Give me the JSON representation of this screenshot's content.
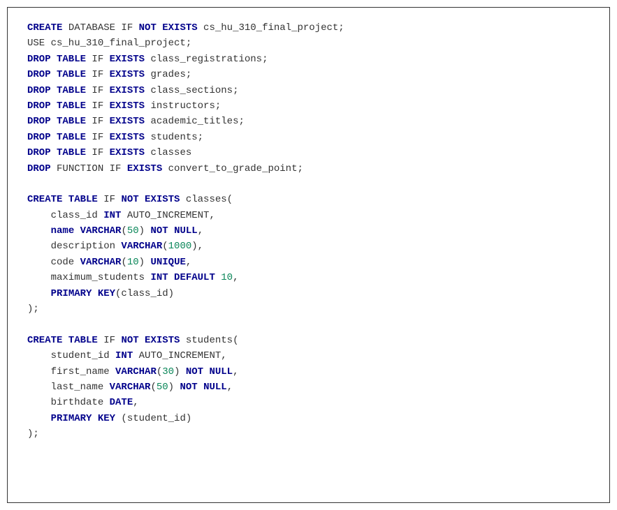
{
  "code": {
    "language": "SQL",
    "lines": [
      {
        "segments": [
          {
            "t": "CREATE",
            "c": "kw"
          },
          {
            "t": " DATABASE IF ",
            "c": "plain"
          },
          {
            "t": "NOT EXISTS",
            "c": "kw"
          },
          {
            "t": " cs_hu_310_final_project;",
            "c": "plain"
          }
        ]
      },
      {
        "segments": [
          {
            "t": "USE cs_hu_310_final_project;",
            "c": "plain"
          }
        ]
      },
      {
        "segments": [
          {
            "t": "DROP TABLE",
            "c": "kw"
          },
          {
            "t": " IF ",
            "c": "plain"
          },
          {
            "t": "EXISTS",
            "c": "kw"
          },
          {
            "t": " class_registrations;",
            "c": "plain"
          }
        ]
      },
      {
        "segments": [
          {
            "t": "DROP TABLE",
            "c": "kw"
          },
          {
            "t": " IF ",
            "c": "plain"
          },
          {
            "t": "EXISTS",
            "c": "kw"
          },
          {
            "t": " grades;",
            "c": "plain"
          }
        ]
      },
      {
        "segments": [
          {
            "t": "DROP TABLE",
            "c": "kw"
          },
          {
            "t": " IF ",
            "c": "plain"
          },
          {
            "t": "EXISTS",
            "c": "kw"
          },
          {
            "t": " class_sections;",
            "c": "plain"
          }
        ]
      },
      {
        "segments": [
          {
            "t": "DROP TABLE",
            "c": "kw"
          },
          {
            "t": " IF ",
            "c": "plain"
          },
          {
            "t": "EXISTS",
            "c": "kw"
          },
          {
            "t": " instructors;",
            "c": "plain"
          }
        ]
      },
      {
        "segments": [
          {
            "t": "DROP TABLE",
            "c": "kw"
          },
          {
            "t": " IF ",
            "c": "plain"
          },
          {
            "t": "EXISTS",
            "c": "kw"
          },
          {
            "t": " academic_titles;",
            "c": "plain"
          }
        ]
      },
      {
        "segments": [
          {
            "t": "DROP TABLE",
            "c": "kw"
          },
          {
            "t": " IF ",
            "c": "plain"
          },
          {
            "t": "EXISTS",
            "c": "kw"
          },
          {
            "t": " students;",
            "c": "plain"
          }
        ]
      },
      {
        "segments": [
          {
            "t": "DROP TABLE",
            "c": "kw"
          },
          {
            "t": " IF ",
            "c": "plain"
          },
          {
            "t": "EXISTS",
            "c": "kw"
          },
          {
            "t": " classes",
            "c": "plain"
          }
        ]
      },
      {
        "segments": [
          {
            "t": "DROP",
            "c": "kw"
          },
          {
            "t": " FUNCTION IF ",
            "c": "plain"
          },
          {
            "t": "EXISTS",
            "c": "kw"
          },
          {
            "t": " convert_to_grade_point;",
            "c": "plain"
          }
        ]
      },
      {
        "segments": [
          {
            "t": "",
            "c": "plain"
          }
        ]
      },
      {
        "segments": [
          {
            "t": "CREATE TABLE",
            "c": "kw"
          },
          {
            "t": " IF ",
            "c": "plain"
          },
          {
            "t": "NOT EXISTS",
            "c": "kw"
          },
          {
            "t": " classes(",
            "c": "plain"
          }
        ]
      },
      {
        "segments": [
          {
            "t": "    class_id ",
            "c": "plain"
          },
          {
            "t": "INT",
            "c": "type"
          },
          {
            "t": " AUTO_INCREMENT,",
            "c": "plain"
          }
        ]
      },
      {
        "segments": [
          {
            "t": "    ",
            "c": "plain"
          },
          {
            "t": "name VARCHAR",
            "c": "type"
          },
          {
            "t": "(",
            "c": "plain"
          },
          {
            "t": "50",
            "c": "num"
          },
          {
            "t": ") ",
            "c": "plain"
          },
          {
            "t": "NOT NULL",
            "c": "kw"
          },
          {
            "t": ",",
            "c": "plain"
          }
        ]
      },
      {
        "segments": [
          {
            "t": "    description ",
            "c": "plain"
          },
          {
            "t": "VARCHAR",
            "c": "type"
          },
          {
            "t": "(",
            "c": "plain"
          },
          {
            "t": "1000",
            "c": "num"
          },
          {
            "t": "),",
            "c": "plain"
          }
        ]
      },
      {
        "segments": [
          {
            "t": "    code ",
            "c": "plain"
          },
          {
            "t": "VARCHAR",
            "c": "type"
          },
          {
            "t": "(",
            "c": "plain"
          },
          {
            "t": "10",
            "c": "num"
          },
          {
            "t": ") ",
            "c": "plain"
          },
          {
            "t": "UNIQUE",
            "c": "kw"
          },
          {
            "t": ",",
            "c": "plain"
          }
        ]
      },
      {
        "segments": [
          {
            "t": "    maximum_students ",
            "c": "plain"
          },
          {
            "t": "INT DEFAULT",
            "c": "type"
          },
          {
            "t": " ",
            "c": "plain"
          },
          {
            "t": "10",
            "c": "num"
          },
          {
            "t": ",",
            "c": "plain"
          }
        ]
      },
      {
        "segments": [
          {
            "t": "    ",
            "c": "plain"
          },
          {
            "t": "PRIMARY KEY",
            "c": "kw"
          },
          {
            "t": "(class_id)",
            "c": "plain"
          }
        ]
      },
      {
        "segments": [
          {
            "t": ");",
            "c": "plain"
          }
        ]
      },
      {
        "segments": [
          {
            "t": "",
            "c": "plain"
          }
        ]
      },
      {
        "segments": [
          {
            "t": "CREATE TABLE",
            "c": "kw"
          },
          {
            "t": " IF ",
            "c": "plain"
          },
          {
            "t": "NOT EXISTS",
            "c": "kw"
          },
          {
            "t": " students(",
            "c": "plain"
          }
        ]
      },
      {
        "segments": [
          {
            "t": "    student_id ",
            "c": "plain"
          },
          {
            "t": "INT",
            "c": "type"
          },
          {
            "t": " AUTO_INCREMENT,",
            "c": "plain"
          }
        ]
      },
      {
        "segments": [
          {
            "t": "    first_name ",
            "c": "plain"
          },
          {
            "t": "VARCHAR",
            "c": "type"
          },
          {
            "t": "(",
            "c": "plain"
          },
          {
            "t": "30",
            "c": "num"
          },
          {
            "t": ") ",
            "c": "plain"
          },
          {
            "t": "NOT NULL",
            "c": "kw"
          },
          {
            "t": ",",
            "c": "plain"
          }
        ]
      },
      {
        "segments": [
          {
            "t": "    last_name ",
            "c": "plain"
          },
          {
            "t": "VARCHAR",
            "c": "type"
          },
          {
            "t": "(",
            "c": "plain"
          },
          {
            "t": "50",
            "c": "num"
          },
          {
            "t": ") ",
            "c": "plain"
          },
          {
            "t": "NOT NULL",
            "c": "kw"
          },
          {
            "t": ",",
            "c": "plain"
          }
        ]
      },
      {
        "segments": [
          {
            "t": "    birthdate ",
            "c": "plain"
          },
          {
            "t": "DATE",
            "c": "type"
          },
          {
            "t": ",",
            "c": "plain"
          }
        ]
      },
      {
        "segments": [
          {
            "t": "    ",
            "c": "plain"
          },
          {
            "t": "PRIMARY KEY",
            "c": "kw"
          },
          {
            "t": " (student_id)",
            "c": "plain"
          }
        ]
      },
      {
        "segments": [
          {
            "t": ");",
            "c": "plain"
          }
        ]
      }
    ]
  }
}
